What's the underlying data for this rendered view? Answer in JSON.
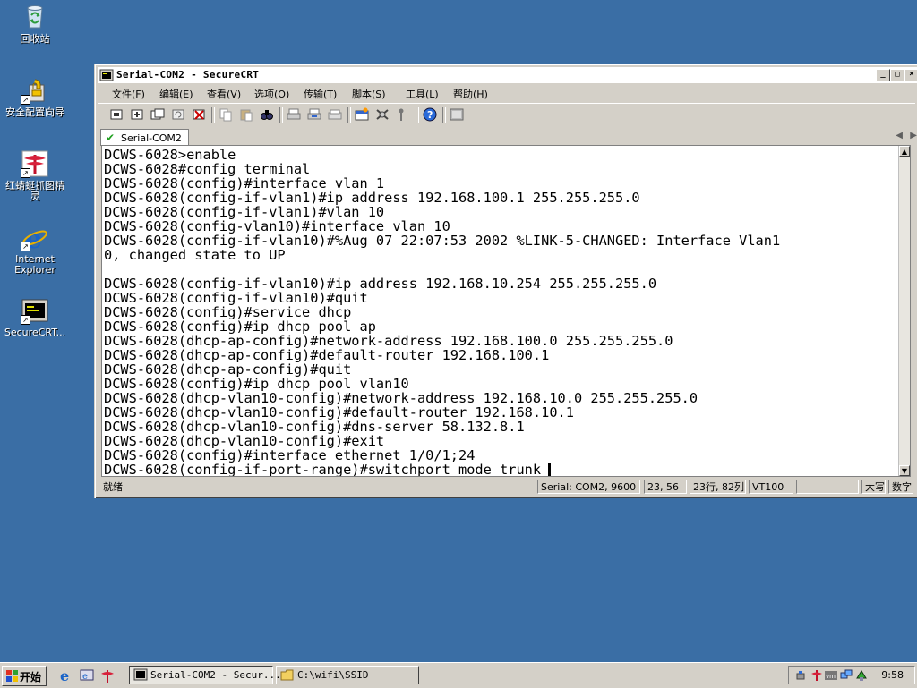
{
  "desktop": {
    "icons": [
      {
        "name": "recycle-bin",
        "label": "回收站"
      },
      {
        "name": "security-wizard",
        "label": "安全配置向导"
      },
      {
        "name": "hongqingting",
        "label": "红蜻蜓抓图精灵"
      },
      {
        "name": "internet-explorer",
        "label": "Internet Explorer"
      },
      {
        "name": "securecrt",
        "label": "SecureCRT..."
      }
    ]
  },
  "window": {
    "title": "Serial-COM2 - SecureCRT",
    "menu": [
      "文件(F)",
      "编辑(E)",
      "查看(V)",
      "选项(O)",
      "传输(T)",
      "脚本(S)",
      "工具(L)",
      "帮助(H)"
    ],
    "tab_label": "Serial-COM2",
    "terminal_lines": [
      "DCWS-6028>enable",
      "DCWS-6028#config terminal",
      "DCWS-6028(config)#interface vlan 1",
      "DCWS-6028(config-if-vlan1)#ip address 192.168.100.1 255.255.255.0",
      "DCWS-6028(config-if-vlan1)#vlan 10",
      "DCWS-6028(config-vlan10)#interface vlan 10",
      "DCWS-6028(config-if-vlan10)#%Aug 07 22:07:53 2002 %LINK-5-CHANGED: Interface Vlan1",
      "0, changed state to UP",
      "",
      "DCWS-6028(config-if-vlan10)#ip address 192.168.10.254 255.255.255.0",
      "DCWS-6028(config-if-vlan10)#quit",
      "DCWS-6028(config)#service dhcp",
      "DCWS-6028(config)#ip dhcp pool ap",
      "DCWS-6028(dhcp-ap-config)#network-address 192.168.100.0 255.255.255.0",
      "DCWS-6028(dhcp-ap-config)#default-router 192.168.100.1",
      "DCWS-6028(dhcp-ap-config)#quit",
      "DCWS-6028(config)#ip dhcp pool vlan10",
      "DCWS-6028(dhcp-vlan10-config)#network-address 192.168.10.0 255.255.255.0",
      "DCWS-6028(dhcp-vlan10-config)#default-router 192.168.10.1",
      "DCWS-6028(dhcp-vlan10-config)#dns-server 58.132.8.1",
      "DCWS-6028(dhcp-vlan10-config)#exit",
      "DCWS-6028(config)#interface ethernet 1/0/1;24",
      "DCWS-6028(config-if-port-range)#switchport mode trunk"
    ],
    "status": {
      "ready": "就绪",
      "connection": "Serial: COM2, 9600",
      "cursor_pos": "23, 56",
      "rows_cols": "23行, 82列",
      "emulation": "VT100",
      "caps": "大写",
      "num": "数字"
    }
  },
  "taskbar": {
    "start_label": "开始",
    "tasks": [
      {
        "label": "Serial-COM2 - Secur...",
        "active": true
      },
      {
        "label": "C:\\wifi\\SSID",
        "active": false
      }
    ],
    "clock": "9:58"
  }
}
